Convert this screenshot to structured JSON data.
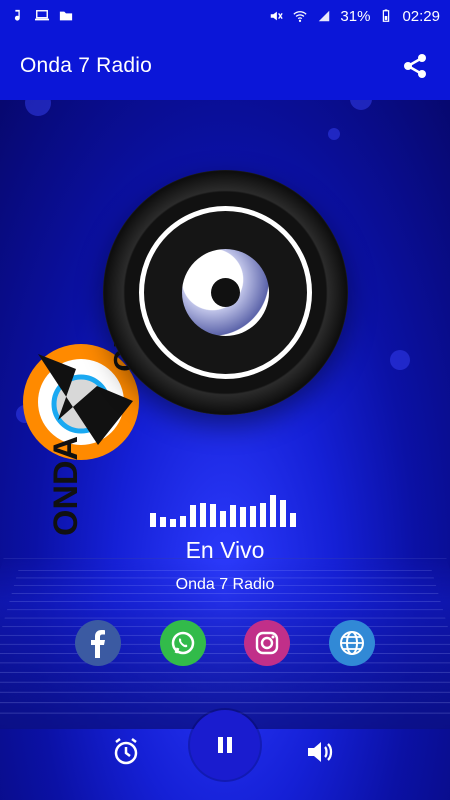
{
  "status_bar": {
    "battery": "31%",
    "time": "02:29",
    "left_icons": [
      "music-note-icon",
      "laptop-icon",
      "folder-icon"
    ],
    "right_icons": [
      "mute-icon",
      "wifi-icon",
      "signal-icon",
      "battery-icon"
    ]
  },
  "header": {
    "title": "Onda 7 Radio",
    "share_icon": "share-icon"
  },
  "player": {
    "logo_text_top": "RADIO",
    "logo_text_bottom": "ONDA",
    "status": "En Vivo",
    "station": "Onda 7 Radio"
  },
  "social": [
    {
      "name": "facebook",
      "icon": "facebook-icon"
    },
    {
      "name": "whatsapp",
      "icon": "whatsapp-icon"
    },
    {
      "name": "instagram",
      "icon": "instagram-icon"
    },
    {
      "name": "website",
      "icon": "globe-icon"
    }
  ],
  "controls": {
    "alarm_icon": "alarm-icon",
    "play_pause_icon": "pause-icon",
    "volume_icon": "volume-icon"
  },
  "colors": {
    "appbar": "#0b16d8",
    "stage_dark": "#07086f",
    "stage_light": "#2d3cff",
    "facebook": "#3b5aa2",
    "whatsapp": "#32bb4a",
    "instagram": "#c12f89",
    "website": "#3189d6"
  }
}
